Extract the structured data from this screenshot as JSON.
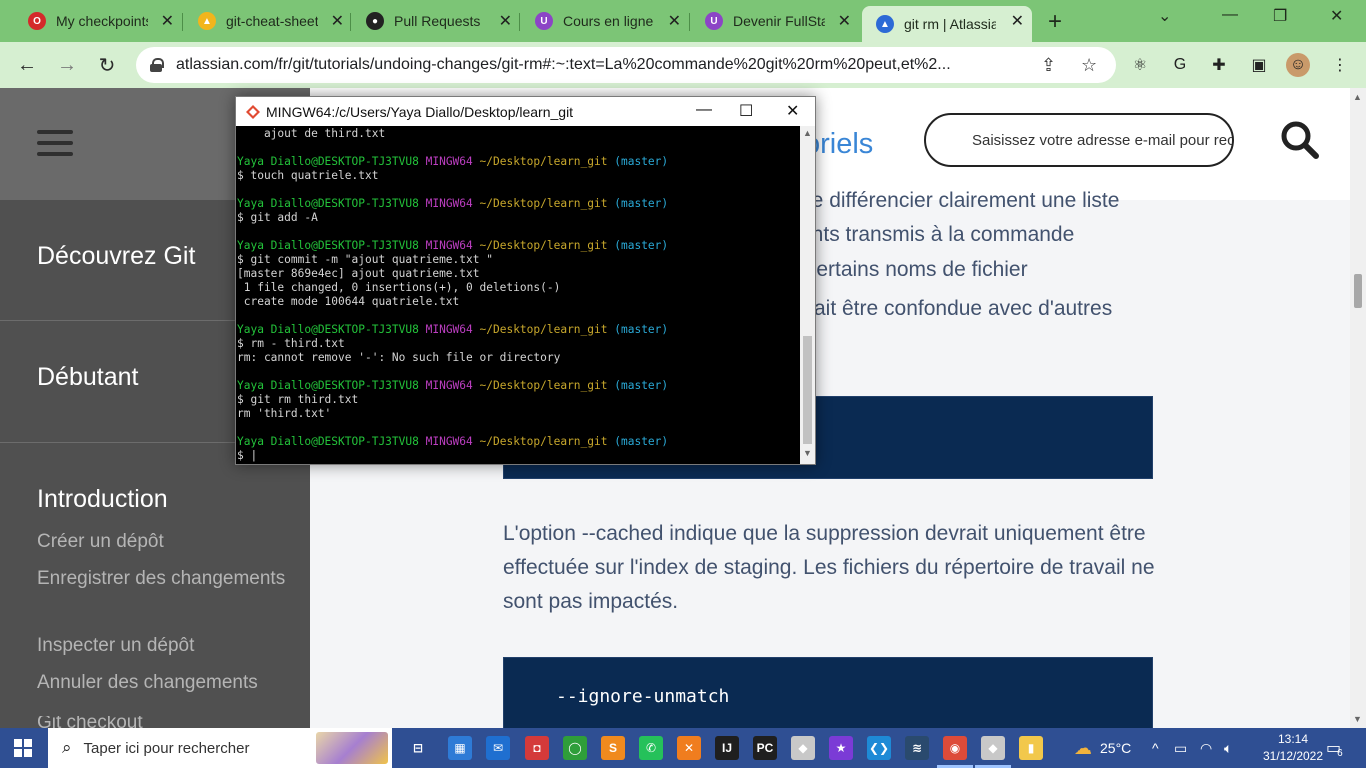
{
  "browser": {
    "tabs": [
      {
        "title": "My checkpoints",
        "icon": "opera-icon",
        "color": "#d42a2a",
        "letter": "O"
      },
      {
        "title": "git-cheat-sheet",
        "icon": "drive-icon",
        "color": "#f2b51c",
        "letter": "▲"
      },
      {
        "title": "Pull Requests",
        "icon": "github-icon",
        "color": "#222222",
        "letter": "●"
      },
      {
        "title": "Cours en ligne",
        "icon": "udemy-icon",
        "color": "#8c45c6",
        "letter": "U"
      },
      {
        "title": "Devenir FullSta",
        "icon": "udemy-icon",
        "color": "#8c45c6",
        "letter": "U"
      },
      {
        "title": "git rm | Atlassia",
        "icon": "atlassian-icon",
        "color": "#2c6ad6",
        "letter": "▲"
      }
    ],
    "url": "atlassian.com/fr/git/tutorials/undoing-changes/git-rm#:~:text=La%20commande%20git%20rm%20peut,et%2..."
  },
  "terminal": {
    "title": "MINGW64:/c/Users/Yaya Diallo/Desktop/learn_git",
    "prompt": {
      "user": "Yaya Diallo@DESKTOP-TJ3TVU8",
      "host": "MINGW64",
      "path": "~/Desktop/learn_git",
      "branch": "(master)"
    },
    "lines": [
      {
        "type": "out",
        "text": "    ajout de third.txt"
      },
      {
        "type": "blank"
      },
      {
        "type": "prompt"
      },
      {
        "type": "cmd",
        "text": "$ touch quatriele.txt"
      },
      {
        "type": "blank"
      },
      {
        "type": "prompt"
      },
      {
        "type": "cmd",
        "text": "$ git add -A"
      },
      {
        "type": "blank"
      },
      {
        "type": "prompt"
      },
      {
        "type": "cmd",
        "text": "$ git commit -m \"ajout quatrieme.txt \""
      },
      {
        "type": "out",
        "text": "[master 869e4ec] ajout quatrieme.txt"
      },
      {
        "type": "out",
        "text": " 1 file changed, 0 insertions(+), 0 deletions(-)"
      },
      {
        "type": "out",
        "text": " create mode 100644 quatriele.txt"
      },
      {
        "type": "blank"
      },
      {
        "type": "prompt"
      },
      {
        "type": "cmd",
        "text": "$ rm - third.txt"
      },
      {
        "type": "out",
        "text": "rm: cannot remove '-': No such file or directory"
      },
      {
        "type": "blank"
      },
      {
        "type": "prompt"
      },
      {
        "type": "cmd",
        "text": "$ git rm third.txt"
      },
      {
        "type": "out",
        "text": "rm 'third.txt'"
      },
      {
        "type": "blank"
      },
      {
        "type": "prompt"
      },
      {
        "type": "cmd",
        "text": "$ |"
      }
    ]
  },
  "sidebar": {
    "sections": [
      "Découvrez Git",
      "Débutant",
      "Introduction"
    ],
    "links": [
      "Créer un dépôt",
      "Enregistrer des changements",
      "Inspecter un dépôt",
      "Annuler des changements",
      "Git checkout"
    ]
  },
  "header": {
    "tutorials_link": "oriels",
    "email_placeholder": "Saisissez votre adresse e-mail pour rec"
  },
  "article": {
    "partial_lines": [
      "ue différencier clairement une liste",
      "ents transmis à la commande",
      " certains noms de fichier",
      "rrait être confondue avec d'autres"
    ],
    "cached_paragraph": "L'option --cached indique que la suppression devrait uniquement être effectuée sur l'index de staging. Les fichiers du répertoire de travail ne sont pas impactés.",
    "code_ignore": "--ignore-unmatch"
  },
  "taskbar": {
    "search_placeholder": "Taper ici pour rechercher",
    "apps": [
      {
        "name": "task-view-icon",
        "color": "transparent",
        "label": "⊟"
      },
      {
        "name": "store-icon",
        "color": "#2e7bd6",
        "label": "▦"
      },
      {
        "name": "mail-icon",
        "color": "#1f6fd0",
        "label": "✉"
      },
      {
        "name": "app-red-icon",
        "color": "#d43a3a",
        "label": "◘"
      },
      {
        "name": "app-green-ring-icon",
        "color": "#2f9e3a",
        "label": "◯"
      },
      {
        "name": "sublime-icon",
        "color": "#f08a1e",
        "label": "S"
      },
      {
        "name": "whatsapp-icon",
        "color": "#25c15a",
        "label": "✆"
      },
      {
        "name": "xampp-icon",
        "color": "#f07d1e",
        "label": "✕"
      },
      {
        "name": "intellij-icon",
        "color": "#1f1f1f",
        "label": "IJ"
      },
      {
        "name": "pycharm-icon",
        "color": "#1f1f1f",
        "label": "PC"
      },
      {
        "name": "git-gui-icon",
        "color": "#c8c8c8",
        "label": "◆"
      },
      {
        "name": "star-app-icon",
        "color": "#7b3bd6",
        "label": "★"
      },
      {
        "name": "vscode-icon",
        "color": "#1e8ad6",
        "label": "❮❯"
      },
      {
        "name": "app-dark-icon",
        "color": "#2a4a6e",
        "label": "≋"
      },
      {
        "name": "chrome-icon",
        "color": "#dd4b39",
        "label": "◉"
      },
      {
        "name": "git-bash-icon",
        "color": "#c8c8c8",
        "label": "◆"
      },
      {
        "name": "file-explorer-icon",
        "color": "#f2c84b",
        "label": "▮"
      }
    ],
    "weather": "25°C",
    "time": "13:14",
    "date": "31/12/2022",
    "notifications": "6"
  }
}
